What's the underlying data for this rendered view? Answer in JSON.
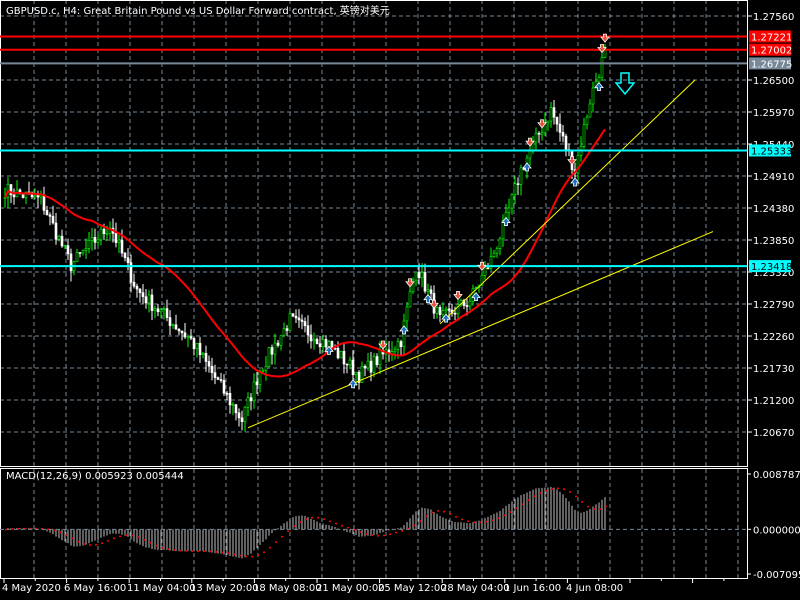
{
  "header": {
    "title": "GBPUSD.c, H4:  Great Britain Pound vs US Dollar Forward contract, 英镑对美元"
  },
  "price_axis": {
    "ticks": [
      "1.27560",
      "1.26500",
      "1.25970",
      "1.25440",
      "1.24910",
      "1.24380",
      "1.23850",
      "1.23320",
      "1.22790",
      "1.22260",
      "1.21730",
      "1.21200",
      "1.20670"
    ]
  },
  "levels": [
    {
      "label": "1.27221",
      "price": 1.27221,
      "color": "#ff0000"
    },
    {
      "label": "1.27002",
      "price": 1.27002,
      "color": "#ff0000"
    },
    {
      "label": "1.26775",
      "price": 1.26775,
      "color": "#778899"
    },
    {
      "label": "1.25333",
      "price": 1.25333,
      "color": "#00ffff"
    },
    {
      "label": "1.23418",
      "price": 1.23418,
      "color": "#00ffff"
    }
  ],
  "trendlines": [
    {
      "from": [
        81,
        1.2074
      ],
      "to": [
        236,
        1.2399
      ],
      "color": "#ffff00"
    },
    {
      "from": [
        145,
        1.2246
      ],
      "to": [
        230,
        1.265
      ],
      "color": "#ffff00"
    }
  ],
  "time_axis": {
    "labels": [
      "4 May 2020",
      "6 May 16:00",
      "11 May 04:00",
      "13 May 20:00",
      "18 May 08:00",
      "21 May 00:00",
      "25 May 12:00",
      "28 May 04:00",
      "1 Jun 16:00",
      "4 Jun 08:00"
    ]
  },
  "price_path": [
    [
      0,
      1.24678
    ],
    [
      12,
      1.24513
    ],
    [
      22,
      1.23436
    ],
    [
      35,
      1.24098
    ],
    [
      44,
      1.23022
    ],
    [
      62,
      1.22194
    ],
    [
      79,
      1.20869
    ],
    [
      85,
      1.21697
    ],
    [
      95,
      1.22525
    ],
    [
      108,
      1.22111
    ],
    [
      118,
      1.21614
    ],
    [
      132,
      1.22194
    ],
    [
      137,
      1.23436
    ],
    [
      145,
      1.22525
    ],
    [
      155,
      1.22857
    ],
    [
      162,
      1.23519
    ],
    [
      167,
      1.24181
    ],
    [
      172,
      1.2501
    ],
    [
      182,
      1.26003
    ],
    [
      190,
      1.2501
    ],
    [
      195,
      1.26169
    ],
    [
      200,
      1.26964
    ]
  ],
  "signals": [
    {
      "bar": 108,
      "dir": "up"
    },
    {
      "bar": 116,
      "dir": "up"
    },
    {
      "bar": 126,
      "dir": "down"
    },
    {
      "bar": 133,
      "dir": "up"
    },
    {
      "bar": 135,
      "dir": "down"
    },
    {
      "bar": 141,
      "dir": "up"
    },
    {
      "bar": 143,
      "dir": "down"
    },
    {
      "bar": 147,
      "dir": "up"
    },
    {
      "bar": 151,
      "dir": "down"
    },
    {
      "bar": 157,
      "dir": "up"
    },
    {
      "bar": 159,
      "dir": "down"
    },
    {
      "bar": 167,
      "dir": "up"
    },
    {
      "bar": 174,
      "dir": "up"
    },
    {
      "bar": 175,
      "dir": "down"
    },
    {
      "bar": 179,
      "dir": "down"
    },
    {
      "bar": 189,
      "dir": "down"
    },
    {
      "bar": 190,
      "dir": "up"
    },
    {
      "bar": 198,
      "dir": "up"
    },
    {
      "bar": 199,
      "dir": "down"
    },
    {
      "bar": 200,
      "dir": "down"
    }
  ],
  "macd": {
    "label": "MACD(12,26,9) 0.005923 0.005444",
    "ticks": [
      "0.008787",
      "0.000000",
      "-0.007095"
    ],
    "max": 0.008787,
    "min": -0.007095
  },
  "colors": {
    "bull": "#00ff00",
    "bear": "#ffffff",
    "ma": "#ff0000",
    "grid": "#778899",
    "signal_down": "#e8503a",
    "signal_up": "#1e6fc0",
    "arrow": "#00ffff"
  }
}
